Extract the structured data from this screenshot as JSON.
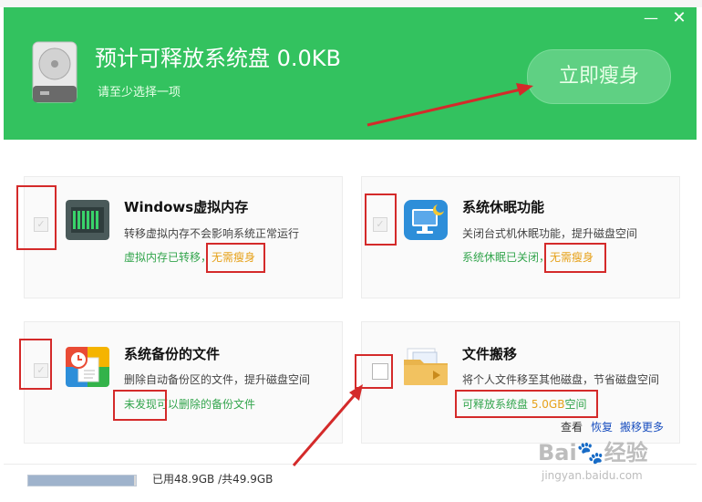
{
  "header": {
    "title": "预计可释放系统盘 0.0KB",
    "subtitle": "请至少选择一项",
    "action_button": "立即瘦身",
    "minimize_glyph": "—",
    "close_glyph": "✕"
  },
  "cards": [
    {
      "title": "Windows虚拟内存",
      "description": "转移虚拟内存不会影响系统正常运行",
      "status_prefix": "虚拟内存已转移，",
      "status_tag": "无需瘦身",
      "checked": true,
      "icon": "memory-chip-icon"
    },
    {
      "title": "系统休眠功能",
      "description": "关闭台式机休眠功能，提升磁盘空间",
      "status_prefix": "系统休眠已关闭，",
      "status_tag": "无需瘦身",
      "checked": true,
      "icon": "hibernate-monitor-icon"
    },
    {
      "title": "系统备份的文件",
      "description": "删除自动备份区的文件，提升磁盘空间",
      "status_prefix": "",
      "status_tag": "未发现可以删除的备份文件",
      "checked": true,
      "icon": "backup-clock-icon"
    },
    {
      "title": "文件搬移",
      "description": "将个人文件移至其他磁盘，节省磁盘空间",
      "status_prefix": "可释放系统盘 ",
      "status_value": "5.0GB",
      "status_suffix": "空间",
      "checked": false,
      "icon": "folder-move-icon",
      "links": [
        "查看",
        "恢复",
        "搬移更多"
      ]
    }
  ],
  "disk": {
    "used_text": "已用48.9GB /共49.9GB",
    "used_fraction": 0.98
  },
  "watermark": {
    "main": "Bai🐾经验",
    "sub": "jingyan.baidu.com"
  },
  "colors": {
    "header_green": "#33c25f",
    "status_green": "#33a54d",
    "accent_gold": "#e6a11a",
    "annotation_red": "#d42a2a"
  }
}
